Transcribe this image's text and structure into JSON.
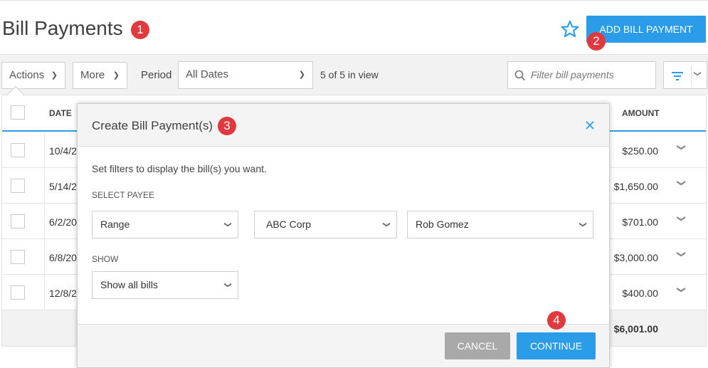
{
  "page": {
    "title": "Bill Payments"
  },
  "callouts": [
    "1",
    "2",
    "3",
    "4"
  ],
  "header": {
    "add_label": "ADD BILL PAYMENT",
    "favorite_icon": "star-outline-icon"
  },
  "toolbar": {
    "actions_label": "Actions",
    "more_label": "More",
    "period_label": "Period",
    "period_value": "All Dates",
    "count_text": "5 of 5 in view",
    "search_placeholder": "Filter bill payments"
  },
  "table": {
    "columns": {
      "date": "DATE",
      "amount": "AMOUNT"
    },
    "rows": [
      {
        "date": "10/4/2",
        "amount": "$250.00"
      },
      {
        "date": "5/14/2",
        "amount": "$1,650.00"
      },
      {
        "date": "6/2/20",
        "amount": "$701.00"
      },
      {
        "date": "6/8/20",
        "amount": "$3,000.00"
      },
      {
        "date": "12/8/2",
        "amount": "$400.00"
      }
    ],
    "total": "$6,001.00"
  },
  "modal": {
    "title": "Create Bill Payment(s)",
    "description": "Set filters to display the bill(s) you want.",
    "payee_label": "SELECT PAYEE",
    "payee_range": "Range",
    "payee_from": "ABC Corp",
    "payee_to": "Rob Gomez",
    "show_label": "SHOW",
    "show_value": "Show all bills",
    "cancel_label": "CANCEL",
    "continue_label": "CONTINUE"
  },
  "colors": {
    "accent": "#2b9ce8",
    "callout": "#e03a3e",
    "cancel": "#a9a9a9"
  }
}
